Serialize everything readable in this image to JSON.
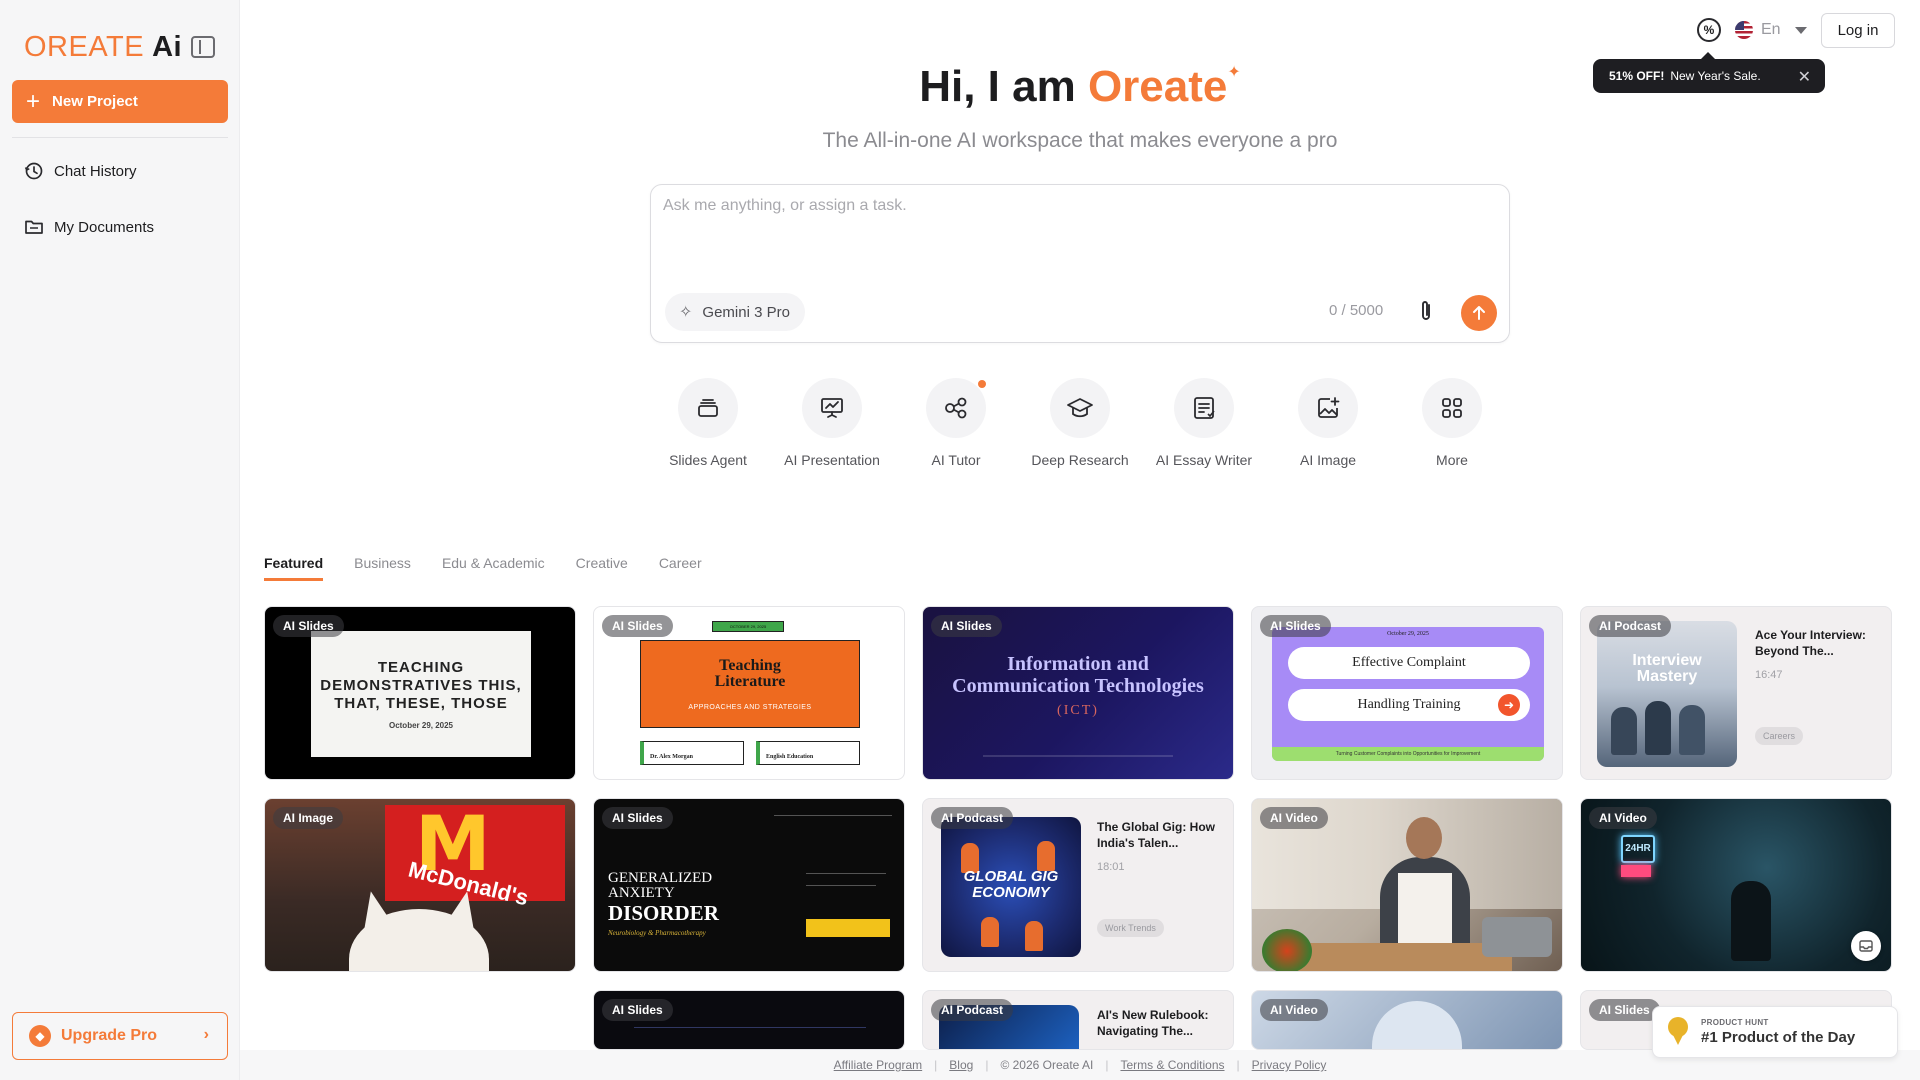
{
  "sidebar": {
    "logo_main": "OREATE",
    "logo_ai": "Ai",
    "new_project": "New Project",
    "items": [
      {
        "label": "Chat History",
        "icon": "history-icon"
      },
      {
        "label": "My Documents",
        "icon": "folder-icon"
      }
    ],
    "upgrade": "Upgrade Pro"
  },
  "topbar": {
    "language": "En",
    "login": "Log in",
    "toast_bold": "51% OFF!",
    "toast_text": "New Year's Sale."
  },
  "hero": {
    "greeting": "Hi, I am ",
    "brand": "Oreate",
    "subtitle": "The All-in-one AI workspace that makes everyone a pro"
  },
  "prompt": {
    "placeholder": "Ask me anything, or assign a task.",
    "model": "Gemini 3 Pro",
    "counter": "0 / 5000"
  },
  "tools": [
    {
      "label": "Slides Agent",
      "icon": "stack-icon"
    },
    {
      "label": "AI Presentation",
      "icon": "presentation-icon"
    },
    {
      "label": "AI Tutor",
      "icon": "nodes-icon"
    },
    {
      "label": "Deep Research",
      "icon": "graduation-cap-icon"
    },
    {
      "label": "AI Essay Writer",
      "icon": "document-edit-icon"
    },
    {
      "label": "AI Image",
      "icon": "image-add-icon"
    },
    {
      "label": "More",
      "icon": "grid-icon"
    }
  ],
  "tabs": [
    "Featured",
    "Business",
    "Edu & Academic",
    "Creative",
    "Career"
  ],
  "cards": {
    "c1": {
      "tag": "AI Slides",
      "title": "TEACHING DEMONSTRATIVES THIS, THAT, THESE, THOSE",
      "date": "October 29, 2025"
    },
    "c2": {
      "tag": "AI Slides",
      "date": "OCTOBER 29, 2025",
      "title": "Teaching Literature",
      "subtitle": "APPROACHES AND STRATEGIES",
      "box1": "Dr. Alex Morgan",
      "box2": "English Education"
    },
    "c3": {
      "tag": "AI Slides",
      "title": "Information and Communication Technologies",
      "subtitle": "(ICT)"
    },
    "c4": {
      "tag": "AI Slides",
      "date": "October 29, 2025",
      "pill1": "Effective Complaint",
      "pill2": "Handling Training",
      "footer": "Turning Customer Complaints into Opportunities for Improvement"
    },
    "c5": {
      "tag": "AI Podcast",
      "art": "Interview Mastery",
      "title": "Ace Your Interview: Beyond The...",
      "time": "16:47",
      "chip": "Careers"
    },
    "c6": {
      "tag": "AI Image",
      "sign": "McDonald's"
    },
    "c7": {
      "tag": "AI Slides",
      "title_a": "GENERALIZED ANXIETY",
      "title_b": "DISORDER",
      "sub": "Neurobiology & Pharmacotherapy"
    },
    "c8": {
      "tag": "AI Podcast",
      "art": "GLOBAL GIG ECONOMY",
      "title": "The Global Gig: How India's Talen...",
      "time": "18:01",
      "chip": "Work Trends"
    },
    "c9": {
      "tag": "AI Video"
    },
    "c10": {
      "tag": "AI Video",
      "neon": "24HR"
    },
    "c11": {
      "tag": "AI Slides"
    },
    "c12": {
      "tag": "AI Podcast",
      "title": "AI's New Rulebook: Navigating The..."
    },
    "c13": {
      "tag": "AI Video"
    },
    "c14": {
      "tag": "AI Slides"
    }
  },
  "product_hunt": {
    "small": "PRODUCT HUNT",
    "big": "#1 Product of the Day"
  },
  "footer": {
    "links": [
      "Affiliate Program",
      "Blog",
      "© 2026 Oreate AI",
      "Terms & Conditions",
      "Privacy Policy"
    ]
  },
  "colors": {
    "accent": "#f47b39",
    "dark": "#1d1d1f"
  }
}
